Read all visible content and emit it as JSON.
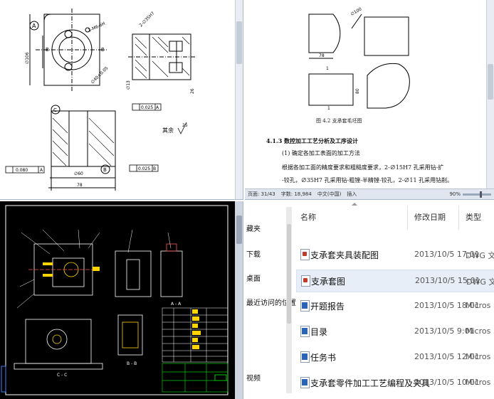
{
  "q1_drawing": {
    "labels": {
      "a": "A",
      "b": "B",
      "c": "C",
      "thread": "3-M6-6H",
      "hole_tl": "2-∅35H7",
      "dia_left": "∅106",
      "dia_bot": "∅40±0.05",
      "dia_mid": "∅13",
      "tol1": "0.025",
      "tol1_ref": "A",
      "tol2": "0.080",
      "tol2_ref": "A",
      "tol3": "0.025",
      "tol3_ref": "B",
      "dim_bottom": "78",
      "dim_right": "26",
      "dim_mid": "∅60",
      "rest": "其余",
      "rough": "25"
    }
  },
  "q2_doc": {
    "caption": "图 4.2  支承套毛坯图",
    "heading": "4.1.3  数控加工工艺分析及工序设计",
    "subheading": "(1) 确定各加工表面的加工方法",
    "body": [
      "根据各加工面的精度要求和粗糙度要求，2-∅15H7 孔采用钻-扩",
      "-铰孔，∅35H7 孔采用钻-粗镗-半精镗-铰孔，2-∅11 孔采用钻削。"
    ],
    "dims": {
      "d100": "∅100",
      "w78": "78",
      "h1": "1",
      "h2": "1",
      "h80": "80"
    },
    "status": {
      "page": "页面: 31/43",
      "words": "字数: 18,984",
      "lang": "中文(中国)",
      "mode": "插入",
      "zoom": "90%"
    }
  },
  "q3_cad": {
    "view_a": "A - A",
    "view_c": "C - C",
    "view_b": "B - B"
  },
  "q4_explorer": {
    "nav_items": [
      "藏夹",
      "下载",
      "桌面",
      "最近访问的位置",
      "视频"
    ],
    "columns": {
      "name": "名称",
      "date": "修改日期",
      "type": "类型"
    },
    "rows": [
      {
        "name": "支承套夹具装配图",
        "date": "2013/10/5 17:01",
        "type": "DWG 文",
        "icon": "dwg"
      },
      {
        "name": "支承套图",
        "date": "2013/10/5 15:01",
        "type": "DWG 文",
        "icon": "dwg"
      },
      {
        "name": "开题报告",
        "date": "2013/10/5 18:01",
        "type": "Micros",
        "icon": "doc"
      },
      {
        "name": "目录",
        "date": "2013/10/5 9:01",
        "type": "Micros",
        "icon": "doc"
      },
      {
        "name": "任务书",
        "date": "2013/10/5 12:01",
        "type": "Micros",
        "icon": "doc"
      },
      {
        "name": "支承套零件加工工艺编程及夹具",
        "date": "2013/10/5 10:01",
        "type": "Micros",
        "icon": "doc"
      }
    ],
    "colors": {
      "selected_row": "#e8eef8"
    }
  }
}
